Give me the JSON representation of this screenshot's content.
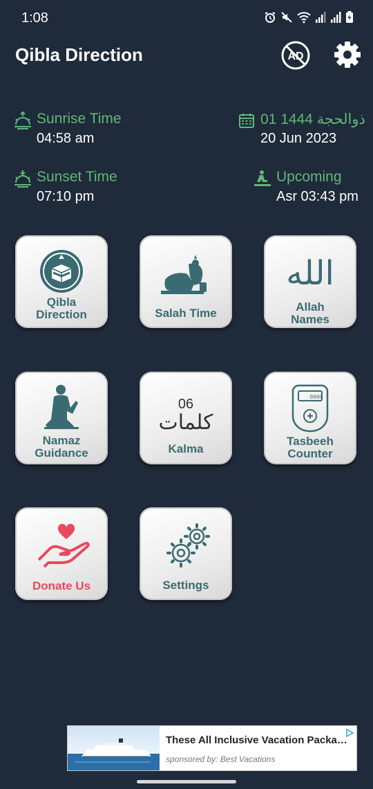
{
  "status_bar": {
    "time": "1:08"
  },
  "header": {
    "title": "Qibla Direction",
    "no_ads_icon": "no-ads-icon",
    "settings_icon": "gear-icon"
  },
  "info": {
    "sunrise": {
      "label": "Sunrise Time",
      "value": "04:58 am"
    },
    "hijri": {
      "label": "01 ذوالحجة 1444",
      "value": "20 Jun 2023"
    },
    "sunset": {
      "label": "Sunset Time",
      "value": "07:10 pm"
    },
    "upcoming": {
      "label": "Upcoming",
      "value": "Asr 03:43 pm"
    }
  },
  "tiles": [
    {
      "label_line1": "Qibla",
      "label_line2": "Direction",
      "icon": "kaaba-icon"
    },
    {
      "label_line1": "Salah Time",
      "icon": "prostration-icon"
    },
    {
      "label_line1": "Allah",
      "label_line2": "Names",
      "icon": "allah-calligraphy-icon",
      "art_text": "الله"
    },
    {
      "label_line1": "Namaz",
      "label_line2": "Guidance",
      "icon": "praying-man-icon"
    },
    {
      "label_line1": "Kalma",
      "icon": "kalma-icon",
      "art_number": "06",
      "art_text": "کلمات"
    },
    {
      "label_line1": "Tasbeeh",
      "label_line2": "Counter",
      "icon": "tasbeeh-counter-icon",
      "art_display": "0000"
    },
    {
      "label_line1": "Donate Us",
      "icon": "donate-heart-hand-icon"
    },
    {
      "label_line1": "Settings",
      "icon": "gears-icon"
    }
  ],
  "colors": {
    "background": "#1f2a3a",
    "accent_green": "#5fb878",
    "tile_text": "#3a6b72",
    "donate_red": "#e84a5a"
  },
  "ad": {
    "title": "These All Inclusive Vacation Package...",
    "sponsor": "sponsored by: Best Vacations"
  }
}
